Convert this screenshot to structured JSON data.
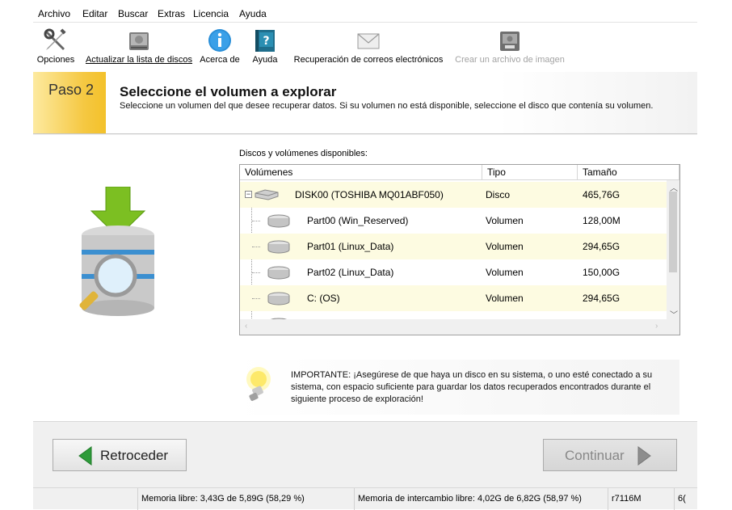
{
  "menu": [
    "Archivo",
    "Editar",
    "Buscar",
    "Extras",
    "Licencia",
    "Ayuda"
  ],
  "toolbar": {
    "options": "Opciones",
    "refresh": "Actualizar la lista de discos",
    "about": "Acerca de",
    "help": "Ayuda",
    "mail": "Recuperación de correos electrónicos",
    "image": "Crear un archivo de imagen"
  },
  "step": {
    "label": "Paso 2",
    "title": "Seleccione el volumen a explorar",
    "description": "Seleccione un volumen del que desee recuperar datos. Si su volumen no está disponible, seleccione el disco que contenía su volumen."
  },
  "disks_label": "Discos y volúmenes disponibles:",
  "table": {
    "columns": [
      "Volúmenes",
      "Tipo",
      "Tamaño"
    ],
    "rows": [
      {
        "name": "DISK00 (TOSHIBA MQ01ABF050)",
        "type": "Disco",
        "size": "465,76G"
      },
      {
        "name": "Part00 (Win_Reserved)",
        "type": "Volumen",
        "size": "128,00M"
      },
      {
        "name": "Part01 (Linux_Data)",
        "type": "Volumen",
        "size": "294,65G"
      },
      {
        "name": "Part02 (Linux_Data)",
        "type": "Volumen",
        "size": "150,00G"
      },
      {
        "name": "C: (OS)",
        "type": "Volumen",
        "size": "294,65G"
      }
    ]
  },
  "tip": "IMPORTANTE: ¡Asegúrese de que haya un disco en su sistema, o uno esté conectado a su sistema, con espacio suficiente para guardar los datos recuperados encontrados durante el siguiente proceso de exploración!",
  "buttons": {
    "back": "Retroceder",
    "next": "Continuar"
  },
  "status": {
    "memory": "Memoria libre: 3,43G de 5,89G (58,29 %)",
    "swap": "Memoria de intercambio libre: 4,02G de 6,82G (58,97 %)",
    "build": "r7116M",
    "extra": "6("
  },
  "colors": {
    "accent": "#f5c842",
    "row_alt": "#fdfbe1",
    "next_arrow": "#2ea043"
  }
}
